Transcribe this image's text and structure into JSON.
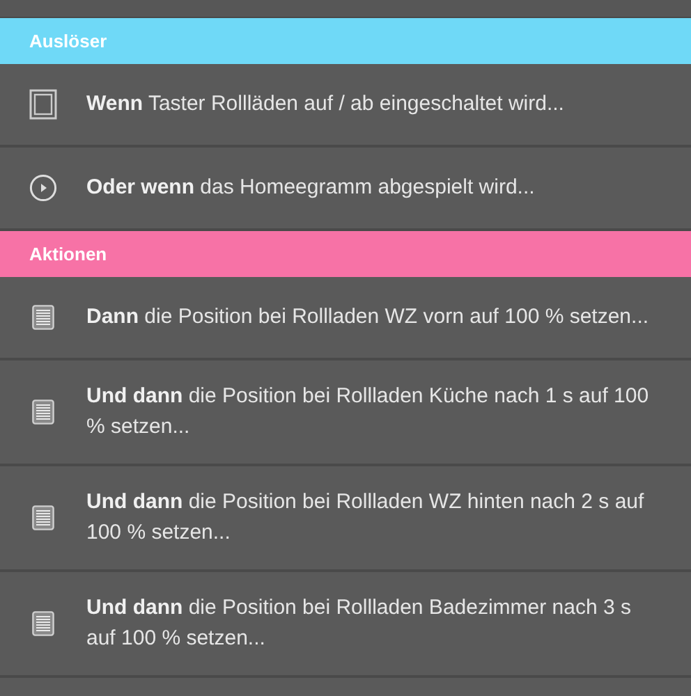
{
  "sections": [
    {
      "title": "Auslöser",
      "color": "#6fd9f7",
      "items": [
        {
          "kind": "switch",
          "text": "**Wenn** Taster Rollläden auf / ab eingeschaltet wird..."
        },
        {
          "kind": "play",
          "text": "**Oder wenn** das Homeegramm abgespielt wird..."
        }
      ]
    },
    {
      "title": "Aktionen",
      "color": "#f772a6",
      "items": [
        {
          "kind": "shutter",
          "text": "**Dann** die Position bei Rollladen WZ vorn auf 100 % setzen..."
        },
        {
          "kind": "shutter",
          "text": "**Und dann** die Position bei Rollladen Küche nach 1 s auf 100 % setzen..."
        },
        {
          "kind": "shutter",
          "text": "**Und dann** die Position bei Rollladen WZ hinten nach 2 s auf 100 % setzen..."
        },
        {
          "kind": "shutter",
          "text": "**Und dann** die Position bei Rollladen Badezimmer nach 3 s auf 100 % setzen..."
        }
      ]
    }
  ]
}
